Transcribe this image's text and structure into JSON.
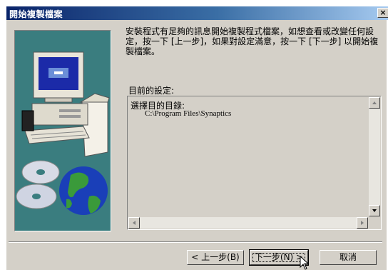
{
  "window": {
    "title": "開始複製檔案",
    "close_label": "×"
  },
  "content": {
    "message": "安裝程式有足夠的訊息開始複製程式檔案，如想查看或改變任何設定，按一下 [上一步]，如果對設定滿意，按一下 [下一步] 以開始複製檔案。",
    "settings_label": "目前的設定:",
    "settings_text": {
      "line1": "選擇目的目錄:",
      "line2": "C:\\Program Files\\Synaptics"
    }
  },
  "buttons": {
    "back_label": "< 上一步(B)",
    "next_label": "下一步(N) >",
    "cancel_label": "取消"
  },
  "colors": {
    "titlebar_start": "#0a246a",
    "titlebar_end": "#a6caf0",
    "dialog_bg": "#d4d0c8",
    "illustration_bg": "#3a7d7f"
  },
  "icons": [
    "close-icon",
    "computer-icon",
    "cd-discs-icon",
    "globe-icon",
    "scroll-up-icon",
    "scroll-down-icon",
    "scroll-left-icon",
    "scroll-right-icon",
    "mouse-cursor-icon"
  ]
}
